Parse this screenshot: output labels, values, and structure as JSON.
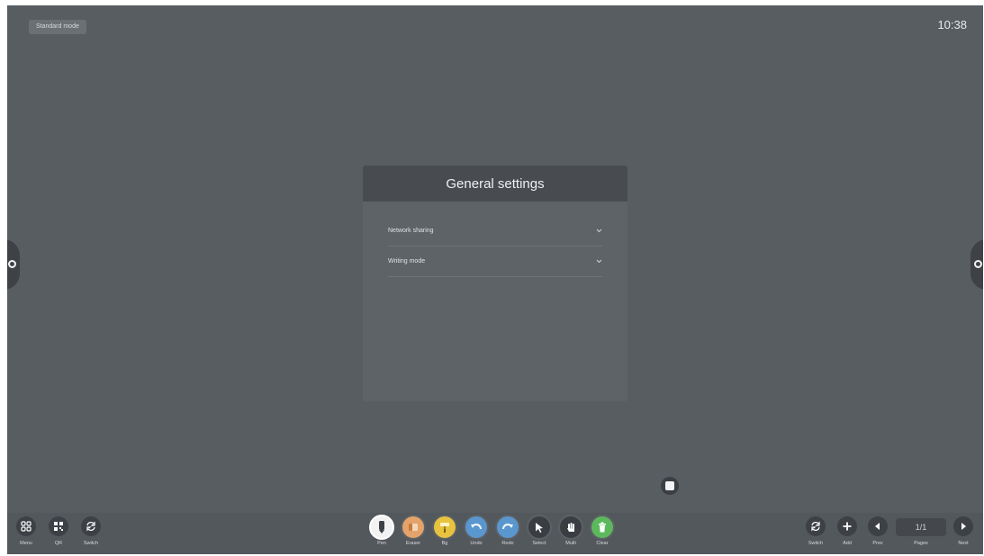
{
  "status": {
    "mode": "Standard mode",
    "time": "10:38"
  },
  "dialog": {
    "title": "General settings",
    "rows": [
      {
        "label": "Network sharing",
        "icon": "chevron-down-icon"
      },
      {
        "label": "Writing mode",
        "icon": "chevron-down-icon"
      }
    ]
  },
  "toolbar": {
    "left": [
      {
        "label": "Menu",
        "icon": "grid-icon"
      },
      {
        "label": "QR",
        "icon": "qr-icon"
      },
      {
        "label": "Switch",
        "icon": "switch-icon"
      }
    ],
    "tools": [
      {
        "label": "Pen",
        "icon": "pen-icon",
        "color": "#f2f2f2"
      },
      {
        "label": "Eraser",
        "icon": "eraser-icon",
        "color": "#e3a36a"
      },
      {
        "label": "Bg",
        "icon": "paint-roller-icon",
        "color": "#e8c33f"
      },
      {
        "label": "Undo",
        "icon": "undo-icon",
        "color": "#5b97cf"
      },
      {
        "label": "Redo",
        "icon": "redo-icon",
        "color": "#5b97cf"
      },
      {
        "label": "Select",
        "icon": "cursor-icon",
        "color": "#3a3e43"
      },
      {
        "label": "Multi",
        "icon": "multi-touch-icon",
        "color": "#3a3e43"
      },
      {
        "label": "Clear",
        "icon": "trash-icon",
        "color": "#5cb85c"
      }
    ],
    "right": [
      {
        "label": "Switch",
        "icon": "switch-icon"
      },
      {
        "label": "Add",
        "icon": "plus-icon"
      },
      {
        "label": "Prev",
        "icon": "prev-icon"
      },
      {
        "label": "Pages",
        "value": "1/1"
      },
      {
        "label": "Next",
        "icon": "next-icon"
      }
    ]
  },
  "colors": {
    "background": "#585d62",
    "dialog_header": "#484c51",
    "dialog_body": "#5e6368"
  }
}
